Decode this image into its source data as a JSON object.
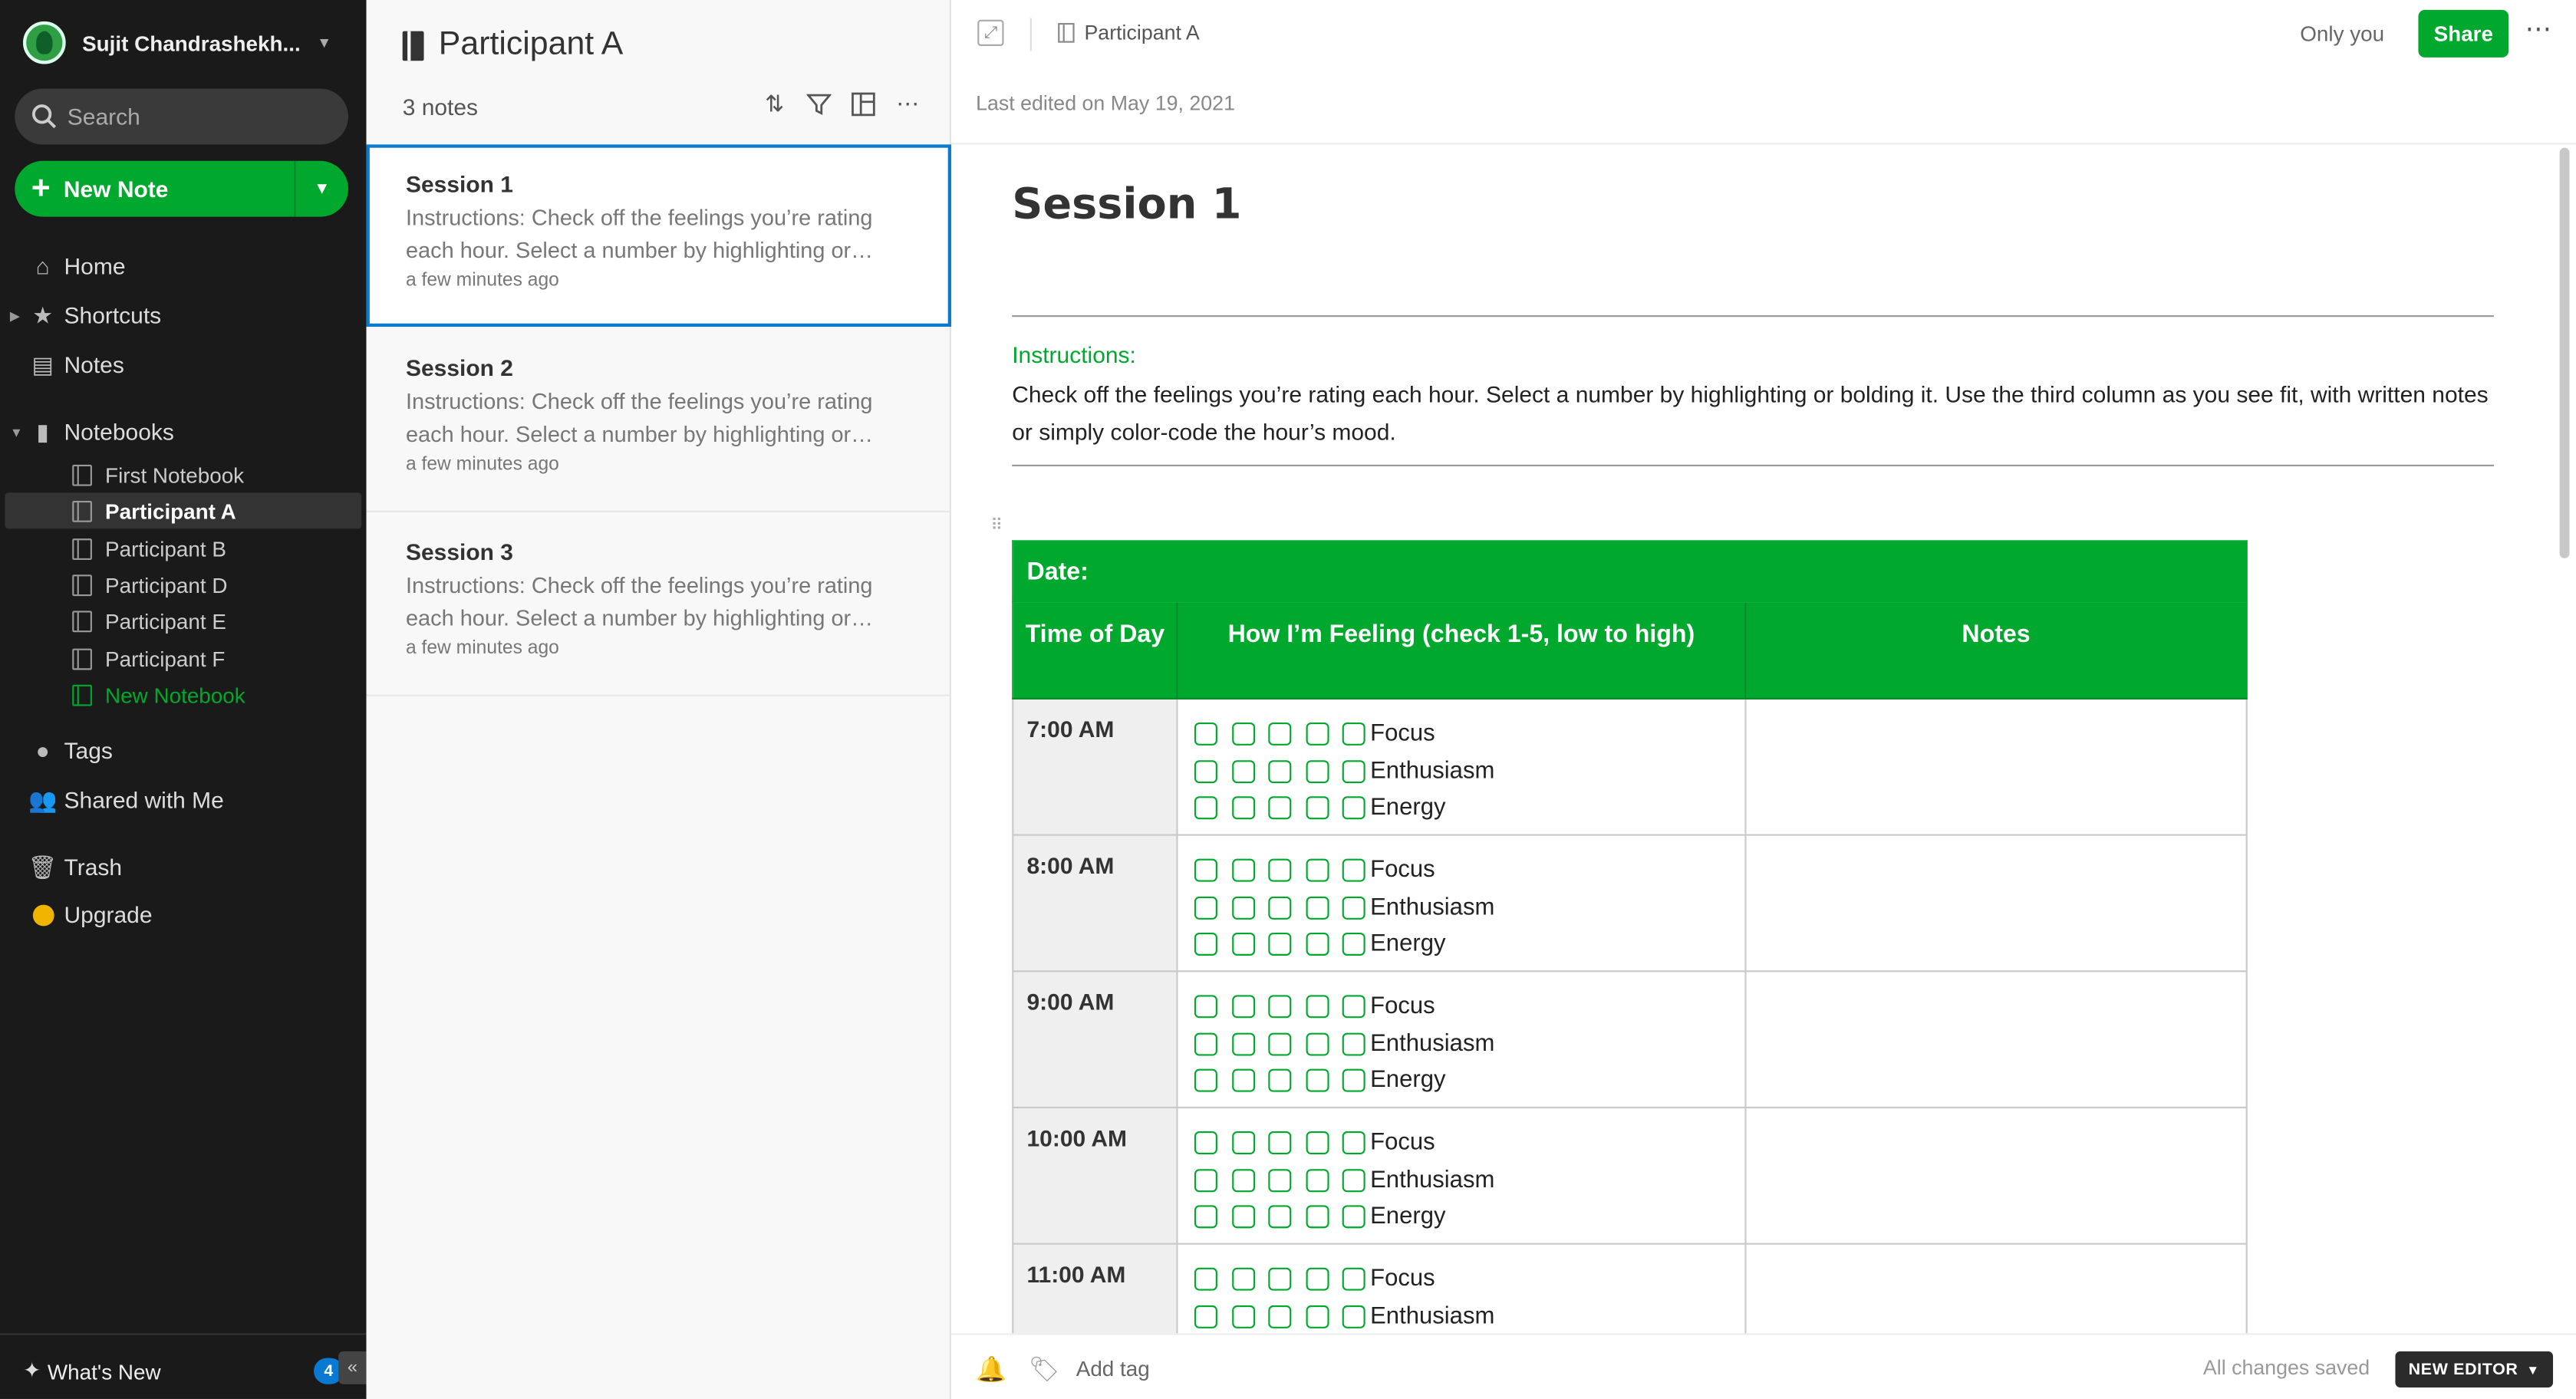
{
  "account": {
    "name": "Sujit Chandrashekh..."
  },
  "search": {
    "placeholder": "Search"
  },
  "new_note": {
    "label": "New Note"
  },
  "nav": {
    "home": "Home",
    "shortcuts": "Shortcuts",
    "notes": "Notes",
    "notebooks": "Notebooks",
    "tags": "Tags",
    "shared": "Shared with Me",
    "trash": "Trash",
    "upgrade": "Upgrade"
  },
  "notebooks": [
    "First Notebook",
    "Participant A",
    "Participant B",
    "Participant D",
    "Participant E",
    "Participant F",
    "New Notebook"
  ],
  "whats_new": {
    "label": "What's New",
    "badge": "4"
  },
  "notelist": {
    "title": "Participant A",
    "count": "3 notes",
    "notes": [
      {
        "title": "Session 1",
        "snippet": "Instructions: Check off the feelings you’re rating each hour. Select a number by highlighting or…",
        "date": "a few minutes ago"
      },
      {
        "title": "Session 2",
        "snippet": "Instructions: Check off the feelings you’re rating each hour. Select a number by highlighting or…",
        "date": "a few minutes ago"
      },
      {
        "title": "Session 3",
        "snippet": "Instructions: Check off the feelings you’re rating each hour. Select a number by highlighting or…",
        "date": "a few minutes ago"
      }
    ]
  },
  "editor": {
    "breadcrumb": "Participant A",
    "visibility": "Only you",
    "share_label": "Share",
    "last_edited": "Last edited on May 19, 2021",
    "title": "Session 1",
    "instructions_heading": "Instructions:",
    "instructions_body": "Check off the feelings you’re rating each hour. Select a number by highlighting or bolding it. Use the third column as you see fit, with written notes or simply color-code the hour’s mood.",
    "table": {
      "date_label": "Date:",
      "headers": [
        "Time of Day",
        "How I’m Feeling (check 1-5, low to high)",
        "Notes"
      ],
      "feelings": [
        "Focus",
        "Enthusiasm",
        "Energy"
      ],
      "times": [
        "7:00 AM",
        "8:00 AM",
        "9:00 AM",
        "10:00 AM",
        "11:00 AM"
      ]
    },
    "add_tag": "Add tag",
    "status": "All changes saved",
    "editor_toggle": "NEW EDITOR"
  },
  "colors": {
    "brand_green": "#00a82d",
    "sidebar_bg": "#1a1a1a",
    "selection_blue": "#0a7ad1"
  },
  "icons": [
    "search-icon",
    "plus-icon",
    "chevron-down-icon",
    "home-icon",
    "star-icon",
    "notes-icon",
    "notebook-icon",
    "tag-icon",
    "people-icon",
    "trash-icon",
    "upgrade-icon",
    "sparkle-icon",
    "sort-icon",
    "filter-icon",
    "view-icon",
    "more-icon",
    "expand-icon",
    "bell-icon",
    "add-tag-icon"
  ]
}
